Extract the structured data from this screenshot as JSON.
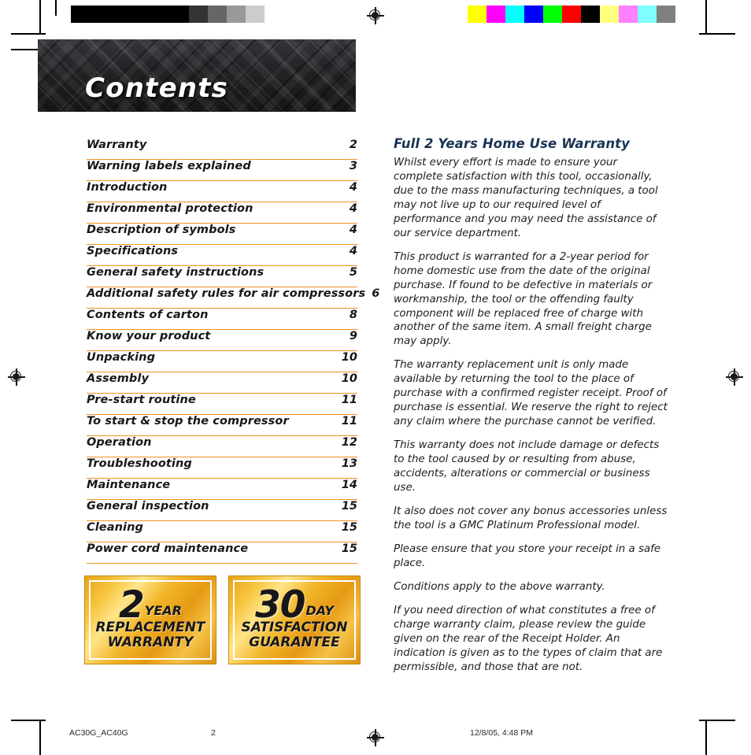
{
  "document": {
    "header_title": "Contents"
  },
  "toc": {
    "entries": [
      {
        "title": "Warranty",
        "page": "2"
      },
      {
        "title": "Warning labels explained",
        "page": "3"
      },
      {
        "title": "Introduction",
        "page": "4"
      },
      {
        "title": "Environmental protection",
        "page": "4"
      },
      {
        "title": "Description of symbols",
        "page": "4"
      },
      {
        "title": "Specifications",
        "page": "4"
      },
      {
        "title": "General safety instructions",
        "page": "5"
      },
      {
        "title": "Additional safety rules for air compressors",
        "page": "6"
      },
      {
        "title": "Contents of carton",
        "page": "8"
      },
      {
        "title": "Know your product",
        "page": "9"
      },
      {
        "title": "Unpacking",
        "page": "10"
      },
      {
        "title": "Assembly",
        "page": "10"
      },
      {
        "title": "Pre-start routine",
        "page": "11"
      },
      {
        "title": "To start & stop the compressor",
        "page": "11"
      },
      {
        "title": "Operation",
        "page": "12"
      },
      {
        "title": "Troubleshooting",
        "page": "13"
      },
      {
        "title": "Maintenance",
        "page": "14"
      },
      {
        "title": "General inspection",
        "page": "15"
      },
      {
        "title": "Cleaning",
        "page": "15"
      },
      {
        "title": "Power cord maintenance",
        "page": "15"
      }
    ]
  },
  "badges": [
    {
      "number": "2",
      "unit": "YEAR",
      "line1": "REPLACEMENT",
      "line2": "WARRANTY"
    },
    {
      "number": "30",
      "unit": "DAY",
      "line1": "SATISFACTION",
      "line2": "GUARANTEE"
    }
  ],
  "warranty": {
    "heading": "Full 2 Years Home Use Warranty",
    "paragraphs": [
      "Whilst every effort is made to ensure your complete satisfaction with this tool, occasionally, due to the mass manufacturing techniques, a tool may not live up to our required level of performance and you may need the assistance of our service department.",
      "This product is warranted for a 2-year period for home domestic use from the date of the original purchase. If found to be defective in materials or workmanship, the tool or the offending faulty component will be replaced free of charge with another of the same item. A small freight charge may apply.",
      "The warranty replacement unit is only made available by returning the tool to the place of purchase with a confirmed register receipt. Proof of purchase is essential. We reserve the right to reject any claim where the purchase cannot be verified.",
      "This warranty does not include damage or defects to the tool caused by or resulting from abuse, accidents, alterations or commercial or business use.",
      "It also does not cover any bonus accessories unless the tool is a GMC Platinum Professional model.",
      "Please ensure that you store your receipt in a safe place.",
      "Conditions apply to the above warranty.",
      "If you need direction of what constitutes a free of charge warranty claim, please review the guide given on the rear of the Receipt Holder. An indication is given as to the types of claim that are permissible, and those that are not."
    ]
  },
  "footer": {
    "document_id": "AC30G_AC40G",
    "page_number": "2",
    "timestamp": "12/8/05, 4:48 PM"
  },
  "print_marks": {
    "grayscale_bar": [
      "#000000",
      "#000000",
      "#000000",
      "#333333",
      "#666666",
      "#999999",
      "#cccccc",
      "#ffffff"
    ],
    "color_bar": [
      "#ffff00",
      "#ff00ff",
      "#00ffff",
      "#0000ff",
      "#00ff00",
      "#ff0000",
      "#000000",
      "#ffff80",
      "#ff80ff",
      "#80ffff",
      "#808080"
    ],
    "accent_rule_color": "#F0921E",
    "heading_color": "#1a3553"
  }
}
